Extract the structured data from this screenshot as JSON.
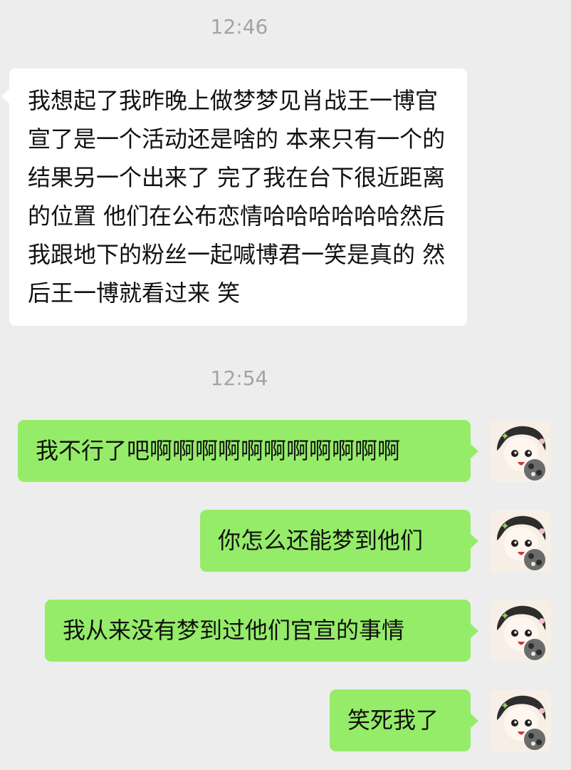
{
  "chat": {
    "messages": [
      {
        "timestamp": "12:46",
        "text": "我想起了我昨晚上做梦梦见肖战王一博官宣了是一个活动还是啥的 本来只有一个的结果另一个出来了 完了我在台下很近距离的位置 他们在公布恋情哈哈哈哈哈哈然后我跟地下的粉丝一起喊博君一笑是真的 然后王一博就看过来 笑"
      },
      {
        "timestamp": "12:54",
        "text": "我不行了吧啊啊啊啊啊啊啊啊啊啊啊"
      },
      {
        "text": "你怎么还能梦到他们"
      },
      {
        "text": "我从来没有梦到过他们官宣的事情"
      },
      {
        "text": "笑死我了"
      }
    ]
  },
  "theme": {
    "background": "#ededed",
    "incoming_bubble": "#ffffff",
    "outgoing_bubble": "#95ec69",
    "timestamp_color": "#a3a3a3"
  },
  "avatar": {
    "icon": "cartoon-avatar-icon"
  }
}
